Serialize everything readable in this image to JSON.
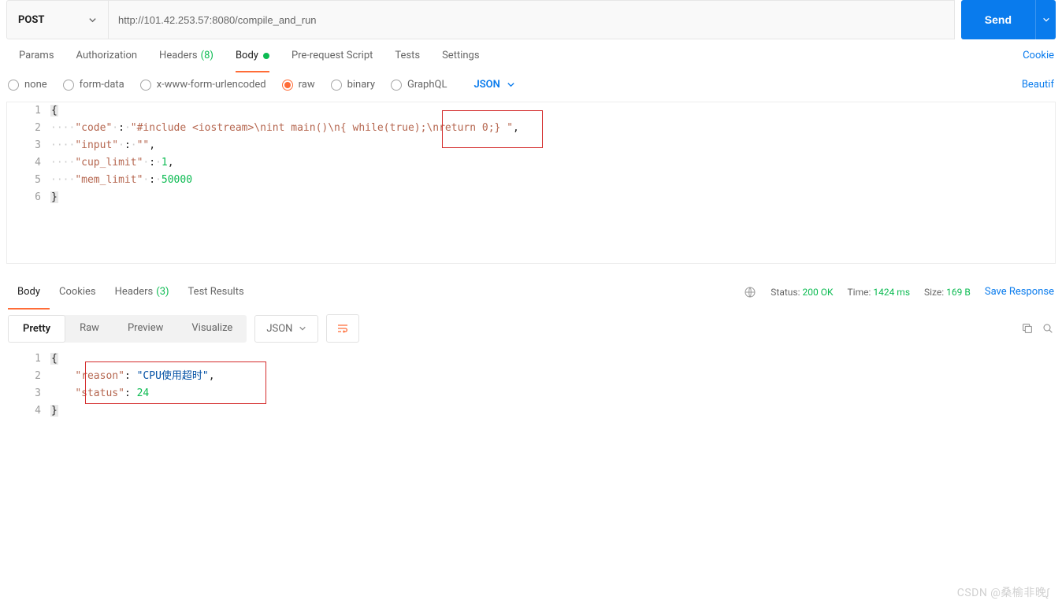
{
  "request": {
    "method": "POST",
    "url": "http://101.42.253.57:8080/compile_and_run",
    "send_label": "Send"
  },
  "req_tabs": {
    "params": "Params",
    "authorization": "Authorization",
    "headers": "Headers",
    "headers_count": "(8)",
    "body": "Body",
    "prerequest": "Pre-request Script",
    "tests": "Tests",
    "settings": "Settings",
    "cookies_link": "Cookie"
  },
  "body_types": {
    "none": "none",
    "formdata": "form-data",
    "urlencoded": "x-www-form-urlencoded",
    "raw": "raw",
    "binary": "binary",
    "graphql": "GraphQL",
    "format": "JSON",
    "beautify": "Beautif"
  },
  "request_body": {
    "code_key": "\"code\"",
    "code_val_1": "\"#include <iostream>\\nint main()\\n{",
    "code_val_2": " while(true);",
    "code_val_3": "\\nreturn 0;} \"",
    "input_key": "\"input\"",
    "input_val": "\"\"",
    "cup_key": "\"cup_limit\"",
    "cup_val": "1",
    "mem_key": "\"mem_limit\"",
    "mem_val": "50000"
  },
  "resp_tabs": {
    "body": "Body",
    "cookies": "Cookies",
    "headers": "Headers",
    "headers_count": "(3)",
    "test_results": "Test Results"
  },
  "status": {
    "status_label": "Status:",
    "status_val": "200 OK",
    "time_label": "Time:",
    "time_val": "1424 ms",
    "size_label": "Size:",
    "size_val": "169 B",
    "save": "Save Response"
  },
  "view_tabs": {
    "pretty": "Pretty",
    "raw": "Raw",
    "preview": "Preview",
    "visualize": "Visualize",
    "format": "JSON"
  },
  "response_body": {
    "reason_key": "\"reason\"",
    "reason_val": "\"CPU使用超时\"",
    "status_key": "\"status\"",
    "status_val": "24"
  },
  "watermark": "CSDN @桑榆非晚ᶘ"
}
